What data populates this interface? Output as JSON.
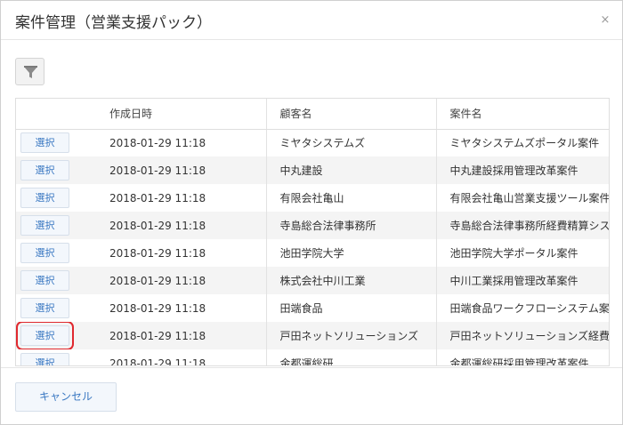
{
  "dialog": {
    "title": "案件管理（営業支援パック）",
    "close_label": "×"
  },
  "table": {
    "headers": {
      "date": "作成日時",
      "client": "顧客名",
      "case": "案件名"
    },
    "rows": [
      {
        "select": "選択",
        "date": "2018-01-29 11:18",
        "client": "ミヤタシステムズ",
        "case": "ミヤタシステムズポータル案件"
      },
      {
        "select": "選択",
        "date": "2018-01-29 11:18",
        "client": "中丸建設",
        "case": "中丸建設採用管理改革案件"
      },
      {
        "select": "選択",
        "date": "2018-01-29 11:18",
        "client": "有限会社亀山",
        "case": "有限会社亀山営業支援ツール案件"
      },
      {
        "select": "選択",
        "date": "2018-01-29 11:18",
        "client": "寺島総合法律事務所",
        "case": "寺島総合法律事務所経費精算システム案"
      },
      {
        "select": "選択",
        "date": "2018-01-29 11:18",
        "client": "池田学院大学",
        "case": "池田学院大学ポータル案件"
      },
      {
        "select": "選択",
        "date": "2018-01-29 11:18",
        "client": "株式会社中川工業",
        "case": "中川工業採用管理改革案件"
      },
      {
        "select": "選択",
        "date": "2018-01-29 11:18",
        "client": "田端食品",
        "case": "田端食品ワークフローシステム案件"
      },
      {
        "select": "選択",
        "date": "2018-01-29 11:18",
        "client": "戸田ネットソリューションズ",
        "case": "戸田ネットソリューションズ経費精算シ"
      },
      {
        "select": "選択",
        "date": "2018-01-29 11:18",
        "client": "金都運総研",
        "case": "金都運総研採用管理改革案件"
      }
    ]
  },
  "footer": {
    "cancel_label": "キャンセル"
  },
  "colors": {
    "highlight": "#e0282e",
    "accent": "#3a78c2"
  },
  "icons": {
    "filter": "filter-funnel-icon",
    "close": "close-icon"
  }
}
